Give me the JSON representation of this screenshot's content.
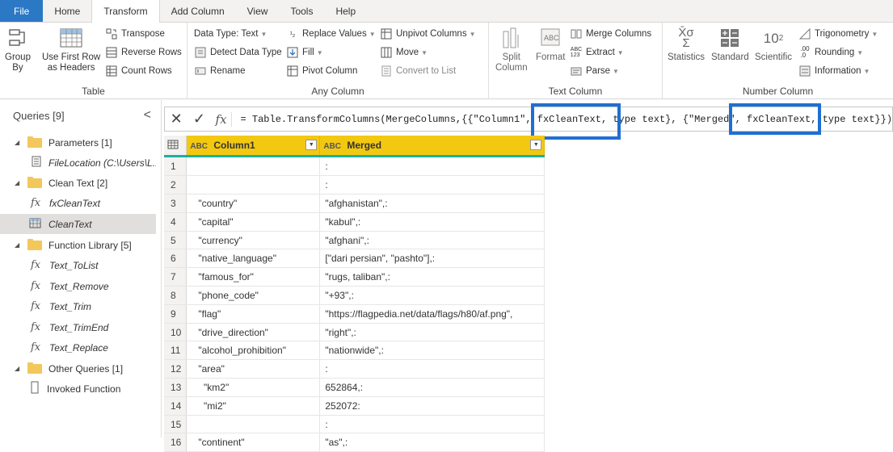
{
  "tabs": [
    {
      "label": "File"
    },
    {
      "label": "Home"
    },
    {
      "label": "Transform"
    },
    {
      "label": "Add Column"
    },
    {
      "label": "View"
    },
    {
      "label": "Tools"
    },
    {
      "label": "Help"
    }
  ],
  "ribbon": {
    "table": {
      "label": "Table",
      "group_by": "Group\nBy",
      "use_first_row": "Use First Row\nas Headers",
      "transpose": "Transpose",
      "reverse_rows": "Reverse Rows",
      "count_rows": "Count Rows"
    },
    "any_column": {
      "label": "Any Column",
      "data_type": "Data Type: Text",
      "detect_data_type": "Detect Data Type",
      "rename": "Rename",
      "replace_values": "Replace Values",
      "fill": "Fill",
      "pivot_column": "Pivot Column",
      "unpivot_columns": "Unpivot Columns",
      "move": "Move",
      "convert_to_list": "Convert to List"
    },
    "text_column": {
      "label": "Text Column",
      "split_column": "Split\nColumn",
      "format": "Format",
      "merge_columns": "Merge Columns",
      "extract": "Extract",
      "parse": "Parse"
    },
    "number_column": {
      "label": "Number Column",
      "statistics": "Statistics",
      "standard": "Standard",
      "scientific": "Scientific",
      "trigonometry": "Trigonometry",
      "rounding": "Rounding",
      "information": "Information"
    }
  },
  "queries": {
    "title": "Queries [9]",
    "collapse": "<",
    "items": [
      {
        "type": "folder",
        "label": "Parameters [1]"
      },
      {
        "type": "param",
        "label": "FileLocation (C:\\Users\\L..."
      },
      {
        "type": "folder",
        "label": "Clean Text [2]"
      },
      {
        "type": "function",
        "label": "fxCleanText"
      },
      {
        "type": "table",
        "label": "CleanText"
      },
      {
        "type": "folder",
        "label": "Function Library [5]"
      },
      {
        "type": "function",
        "label": "Text_ToList"
      },
      {
        "type": "function",
        "label": "Text_Remove"
      },
      {
        "type": "function",
        "label": "Text_Trim"
      },
      {
        "type": "function",
        "label": "Text_TrimEnd"
      },
      {
        "type": "function",
        "label": "Text_Replace"
      },
      {
        "type": "folder",
        "label": "Other Queries [1]"
      },
      {
        "type": "query",
        "label": "Invoked Function"
      }
    ]
  },
  "formula": {
    "cancel": "✕",
    "commit": "✓",
    "fx": "fx",
    "text": "= Table.TransformColumns(MergeColumns,{{\"Column1\", fxCleanText, type text}, {\"Merged\", fxCleanText, type text}})"
  },
  "grid": {
    "columns": [
      {
        "type": "ABC",
        "name": "Column1"
      },
      {
        "type": "ABC",
        "name": "Merged"
      }
    ],
    "rows": [
      {
        "n": "1",
        "c1": "",
        "c2": ":"
      },
      {
        "n": "2",
        "c1": "",
        "c2": ":"
      },
      {
        "n": "3",
        "c1": "\"country\"",
        "c2": "\"afghanistan\",:"
      },
      {
        "n": "4",
        "c1": "\"capital\"",
        "c2": "\"kabul\",:"
      },
      {
        "n": "5",
        "c1": "\"currency\"",
        "c2": "\"afghani\",:"
      },
      {
        "n": "6",
        "c1": "\"native_language\"",
        "c2": "[\"dari persian\", \"pashto\"],:"
      },
      {
        "n": "7",
        "c1": "\"famous_for\"",
        "c2": "\"rugs, taliban\",:"
      },
      {
        "n": "8",
        "c1": "\"phone_code\"",
        "c2": "\"+93\",:"
      },
      {
        "n": "9",
        "c1": "\"flag\"",
        "c2": "\"https://flagpedia.net/data/flags/h80/af.png\","
      },
      {
        "n": "10",
        "c1": "\"drive_direction\"",
        "c2": "\"right\",:"
      },
      {
        "n": "11",
        "c1": "\"alcohol_prohibition\"",
        "c2": "\"nationwide\",:"
      },
      {
        "n": "12",
        "c1": "\"area\"",
        "c2": ":"
      },
      {
        "n": "13",
        "c1": "  \"km2\"",
        "c2": "652864,:"
      },
      {
        "n": "14",
        "c1": "  \"mi2\"",
        "c2": "252072:"
      },
      {
        "n": "15",
        "c1": "",
        "c2": ":"
      },
      {
        "n": "16",
        "c1": "\"continent\"",
        "c2": "\"as\",:"
      }
    ]
  }
}
